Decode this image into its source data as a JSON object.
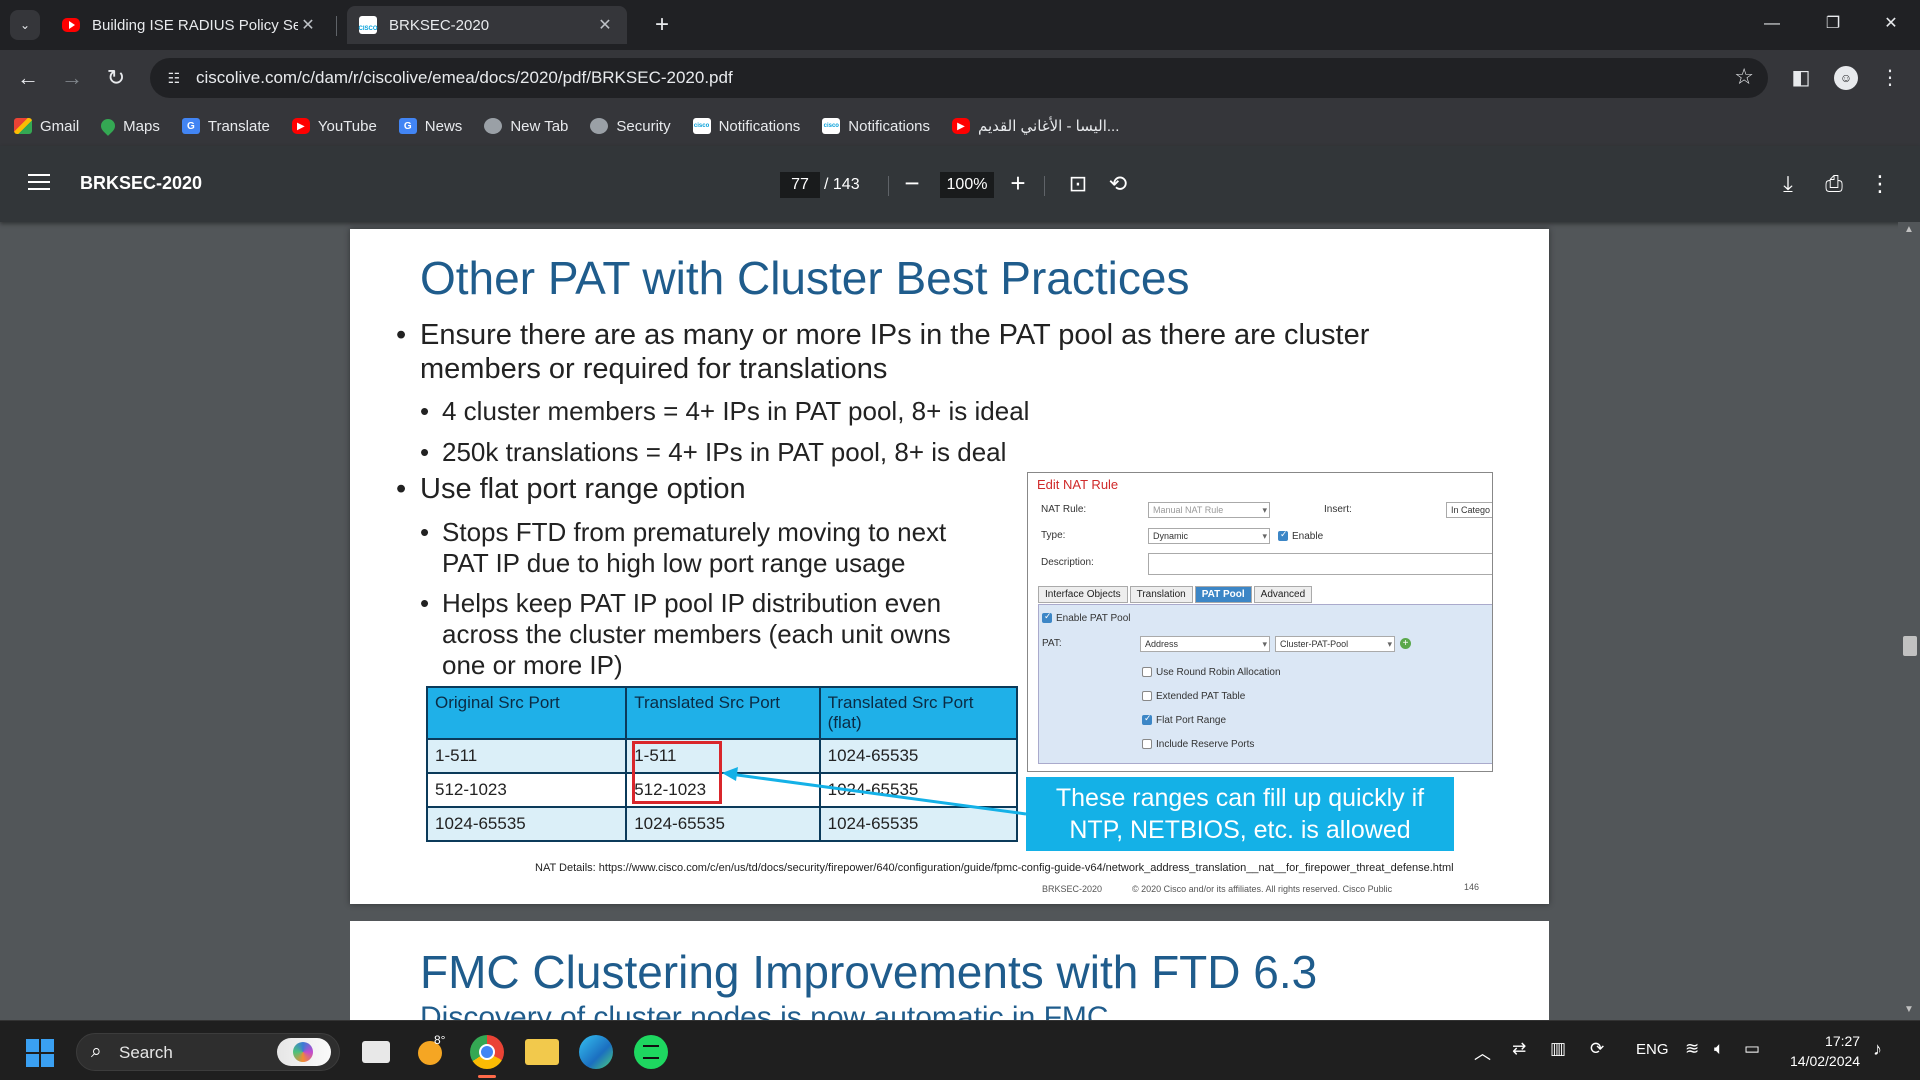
{
  "browser": {
    "tabs": [
      {
        "title": "Building ISE RADIUS Policy Sets",
        "active": false
      },
      {
        "title": "BRKSEC-2020",
        "active": true
      }
    ],
    "url": "ciscolive.com/c/dam/r/ciscolive/emea/docs/2020/pdf/BRKSEC-2020.pdf",
    "bookmarks": [
      {
        "label": "Gmail",
        "icon": "gmail-icon"
      },
      {
        "label": "Maps",
        "icon": "maps-icon"
      },
      {
        "label": "Translate",
        "icon": "translate-icon"
      },
      {
        "label": "YouTube",
        "icon": "youtube-icon"
      },
      {
        "label": "News",
        "icon": "news-icon"
      },
      {
        "label": "New Tab",
        "icon": "globe-icon"
      },
      {
        "label": "Security",
        "icon": "globe-icon"
      },
      {
        "label": "Notifications",
        "icon": "cisco-icon"
      },
      {
        "label": "Notifications",
        "icon": "cisco-icon"
      },
      {
        "label": "اليسا - الأغاني القديم...",
        "icon": "youtube-icon"
      }
    ]
  },
  "pdf": {
    "title": "BRKSEC-2020",
    "page_current": "77",
    "page_total": "/ 143",
    "zoom": "100%"
  },
  "slide": {
    "title": "Other PAT with Cluster Best Practices",
    "b1_line1": "Ensure there are as many or more IPs in the PAT pool as there are cluster",
    "b1_line2": "members or required for translations",
    "b1a": "4 cluster members = 4+ IPs in PAT pool, 8+ is ideal",
    "b1b": "250k translations = 4+ IPs in PAT pool, 8+ is deal",
    "b2": "Use flat port range option",
    "b2a_line1": "Stops FTD from prematurely moving to next",
    "b2a_line2": "PAT IP due to high low port range usage",
    "b2b_line1": "Helps keep PAT IP pool IP distribution even",
    "b2b_line2": "across the cluster members (each unit owns",
    "b2b_line3": "one or more IP)",
    "table": {
      "headers": [
        "Original Src Port",
        "Translated Src Port",
        "Translated Src Port (flat)"
      ],
      "rows": [
        [
          "1-511",
          "1-511",
          "1024-65535"
        ],
        [
          "512-1023",
          "512-1023",
          "1024-65535"
        ],
        [
          "1024-65535",
          "1024-65535",
          "1024-65535"
        ]
      ]
    },
    "callout_line1": "These ranges can fill up quickly if",
    "callout_line2": "NTP, NETBIOS, etc. is allowed",
    "nat": {
      "heading": "Edit NAT Rule",
      "nat_rule_label": "NAT Rule:",
      "nat_rule_value": "Manual NAT Rule",
      "insert_label": "Insert:",
      "insert_value": "In Catego",
      "type_label": "Type:",
      "type_value": "Dynamic",
      "enable_label": "Enable",
      "description_label": "Description:",
      "tabs": [
        "Interface Objects",
        "Translation",
        "PAT Pool",
        "Advanced"
      ],
      "enable_pat_pool": "Enable PAT Pool",
      "pat_label": "PAT:",
      "pat_type": "Address",
      "pat_object": "Cluster-PAT-Pool",
      "options": [
        "Use Round Robin Allocation",
        "Extended PAT Table",
        "Flat Port Range",
        "Include Reserve Ports"
      ],
      "options_checked": [
        false,
        false,
        true,
        false
      ]
    },
    "footnote": "NAT Details: https://www.cisco.com/c/en/us/td/docs/security/firepower/640/configuration/guide/fpmc-config-guide-v64/network_address_translation__nat__for_firepower_threat_defense.html",
    "footer_code": "BRKSEC-2020",
    "footer_copyright": "© 2020  Cisco and/or its affiliates. All rights reserved.   Cisco Public",
    "footer_page": "146"
  },
  "next_slide": {
    "title": "FMC Clustering Improvements with FTD 6.3",
    "subtitle": "Discovery of cluster nodes is now automatic in FMC"
  },
  "taskbar": {
    "search_label": "Search",
    "temperature": "8°",
    "lang": "ENG",
    "time": "17:27",
    "date": "14/02/2024"
  }
}
